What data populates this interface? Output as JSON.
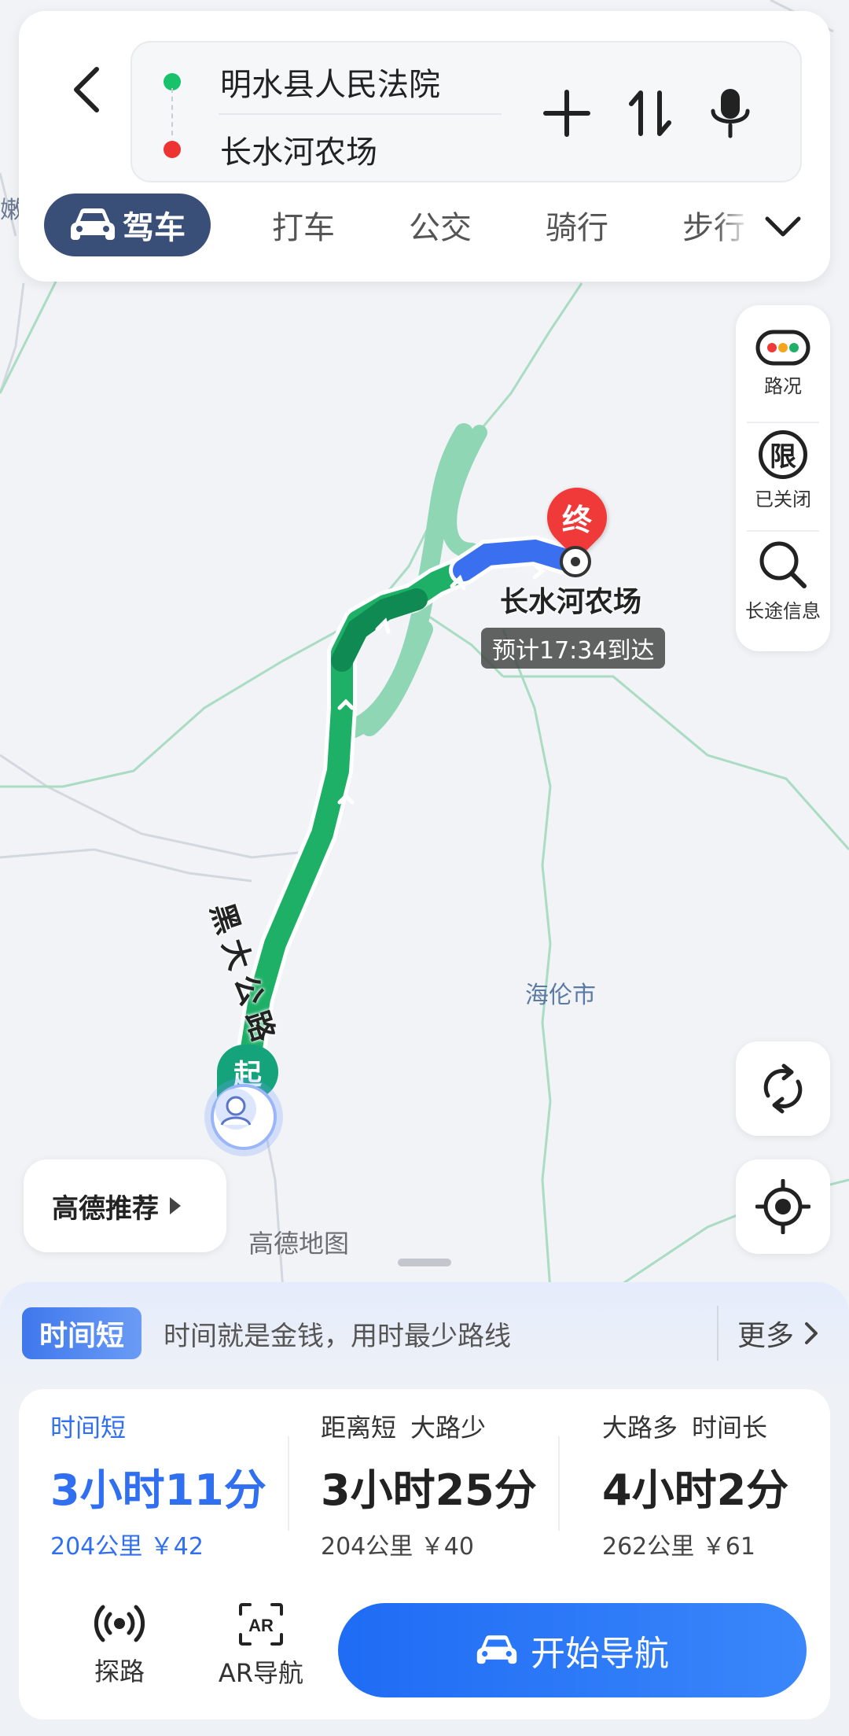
{
  "route": {
    "from": "明水县人民法院",
    "to": "长水河农场"
  },
  "modes": [
    {
      "label": "驾车",
      "active": true
    },
    {
      "label": "打车"
    },
    {
      "label": "公交"
    },
    {
      "label": "骑行"
    },
    {
      "label": "步行"
    }
  ],
  "side_panel": [
    {
      "icon": "traffic-light-icon",
      "label": "路况"
    },
    {
      "icon": "restriction-icon",
      "glyph": "限",
      "label": "已关闭"
    },
    {
      "icon": "search-icon",
      "label": "长途信息"
    }
  ],
  "map": {
    "road_name": "黑大公路",
    "city_label": "海伦市",
    "edge_label": "嫩",
    "destination_name": "长水河农场",
    "end_marker": "终",
    "start_marker": "起",
    "eta": "预计17:34到达",
    "watermark": "高德地图"
  },
  "recommend": {
    "label": "高德推荐"
  },
  "strategy": {
    "tag": "时间短",
    "desc": "时间就是金钱，用时最少路线",
    "more": "更多"
  },
  "options": [
    {
      "tags": [
        "时间短"
      ],
      "time": "3小时11分",
      "distance": "204公里",
      "cost": "￥42",
      "selected": true
    },
    {
      "tags": [
        "距离短",
        "大路少"
      ],
      "time": "3小时25分",
      "distance": "204公里",
      "cost": "￥40",
      "selected": false
    },
    {
      "tags": [
        "大路多",
        "时间长"
      ],
      "time": "4小时2分",
      "distance": "262公里",
      "cost": "￥61",
      "selected": false
    }
  ],
  "tools": [
    {
      "icon": "explore-icon",
      "label": "探路"
    },
    {
      "icon": "ar-icon",
      "label": "AR导航"
    }
  ],
  "start_nav": {
    "label": "开始导航"
  },
  "colors": {
    "accent": "#2f6ff0",
    "route_main": "#1fb068",
    "route_dark": "#0e8a52",
    "route_alt": "#8fd6b4",
    "route_blue": "#3a6ff0",
    "start_green": "#14a37a",
    "end_red": "#f03a3a"
  }
}
